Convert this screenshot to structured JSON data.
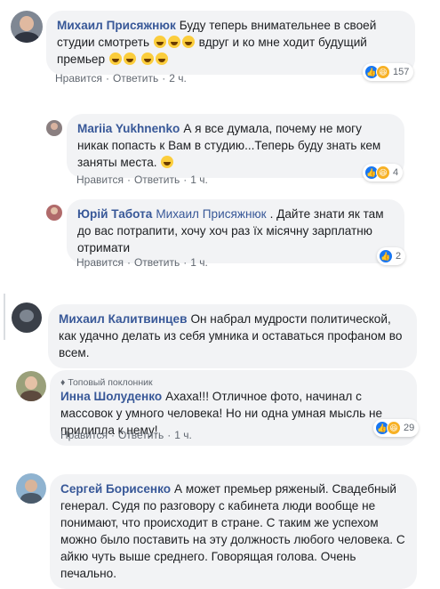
{
  "labels": {
    "like": "Нравится",
    "reply": "Ответить",
    "dot": "·"
  },
  "c1": {
    "author": "Михаил Присяжнюк",
    "text_a": "Буду теперь внимательнее в своей студии смотреть",
    "text_b": "вдруг и ко мне ходит будущий премьер",
    "time": "2 ч.",
    "reaction_count": "157",
    "reactions": [
      "like-icon",
      "haha-icon"
    ]
  },
  "c2": {
    "author": "Mariia Yukhnenko",
    "text": "А я все думала, почему не могу никак попасть к Вам в студию...Теперь буду знать кем заняты места.",
    "time": "1 ч.",
    "reaction_count": "4",
    "reactions": [
      "like-icon",
      "haha-icon"
    ]
  },
  "c3": {
    "author": "Юрій Табота",
    "mention": "Михаил Присяжнюк",
    "text": ". Дайте знати як там до вас потрапити, хочу хоч раз їх місячну зарплатню отримати",
    "time": "1 ч.",
    "reaction_count": "2",
    "reactions": [
      "like-icon"
    ]
  },
  "c4": {
    "author": "Михаил Калитвинцев",
    "text": "Он набрал мудрости политической, как удачно делать из себя умника и оставаться профаном во всем."
  },
  "c5": {
    "badge": "Топовый поклонник",
    "author": "Инна Шолуденко",
    "text": "Ахаха!!! Отличное фото, начинал с массовок у умного человека! Но ни одна умная мысль не прилипла к нему!",
    "time": "1 ч.",
    "reaction_count": "29",
    "reactions": [
      "like-icon",
      "haha-icon"
    ]
  },
  "c6": {
    "author": "Сергей Борисенко",
    "text": "А может премьер ряженый. Свадебный генерал. Судя по разговору с кабинета люди вообще не понимают, что происходит в стране. С таким же успехом можно было поставить на эту должность любого человека. С айкю чуть выше среднего. Говорящая голова. Очень печально."
  },
  "colors": {
    "link": "#385898",
    "bubble": "#f2f3f5",
    "like": "#1877f2",
    "haha": "#f7b125",
    "meta": "#606770"
  }
}
